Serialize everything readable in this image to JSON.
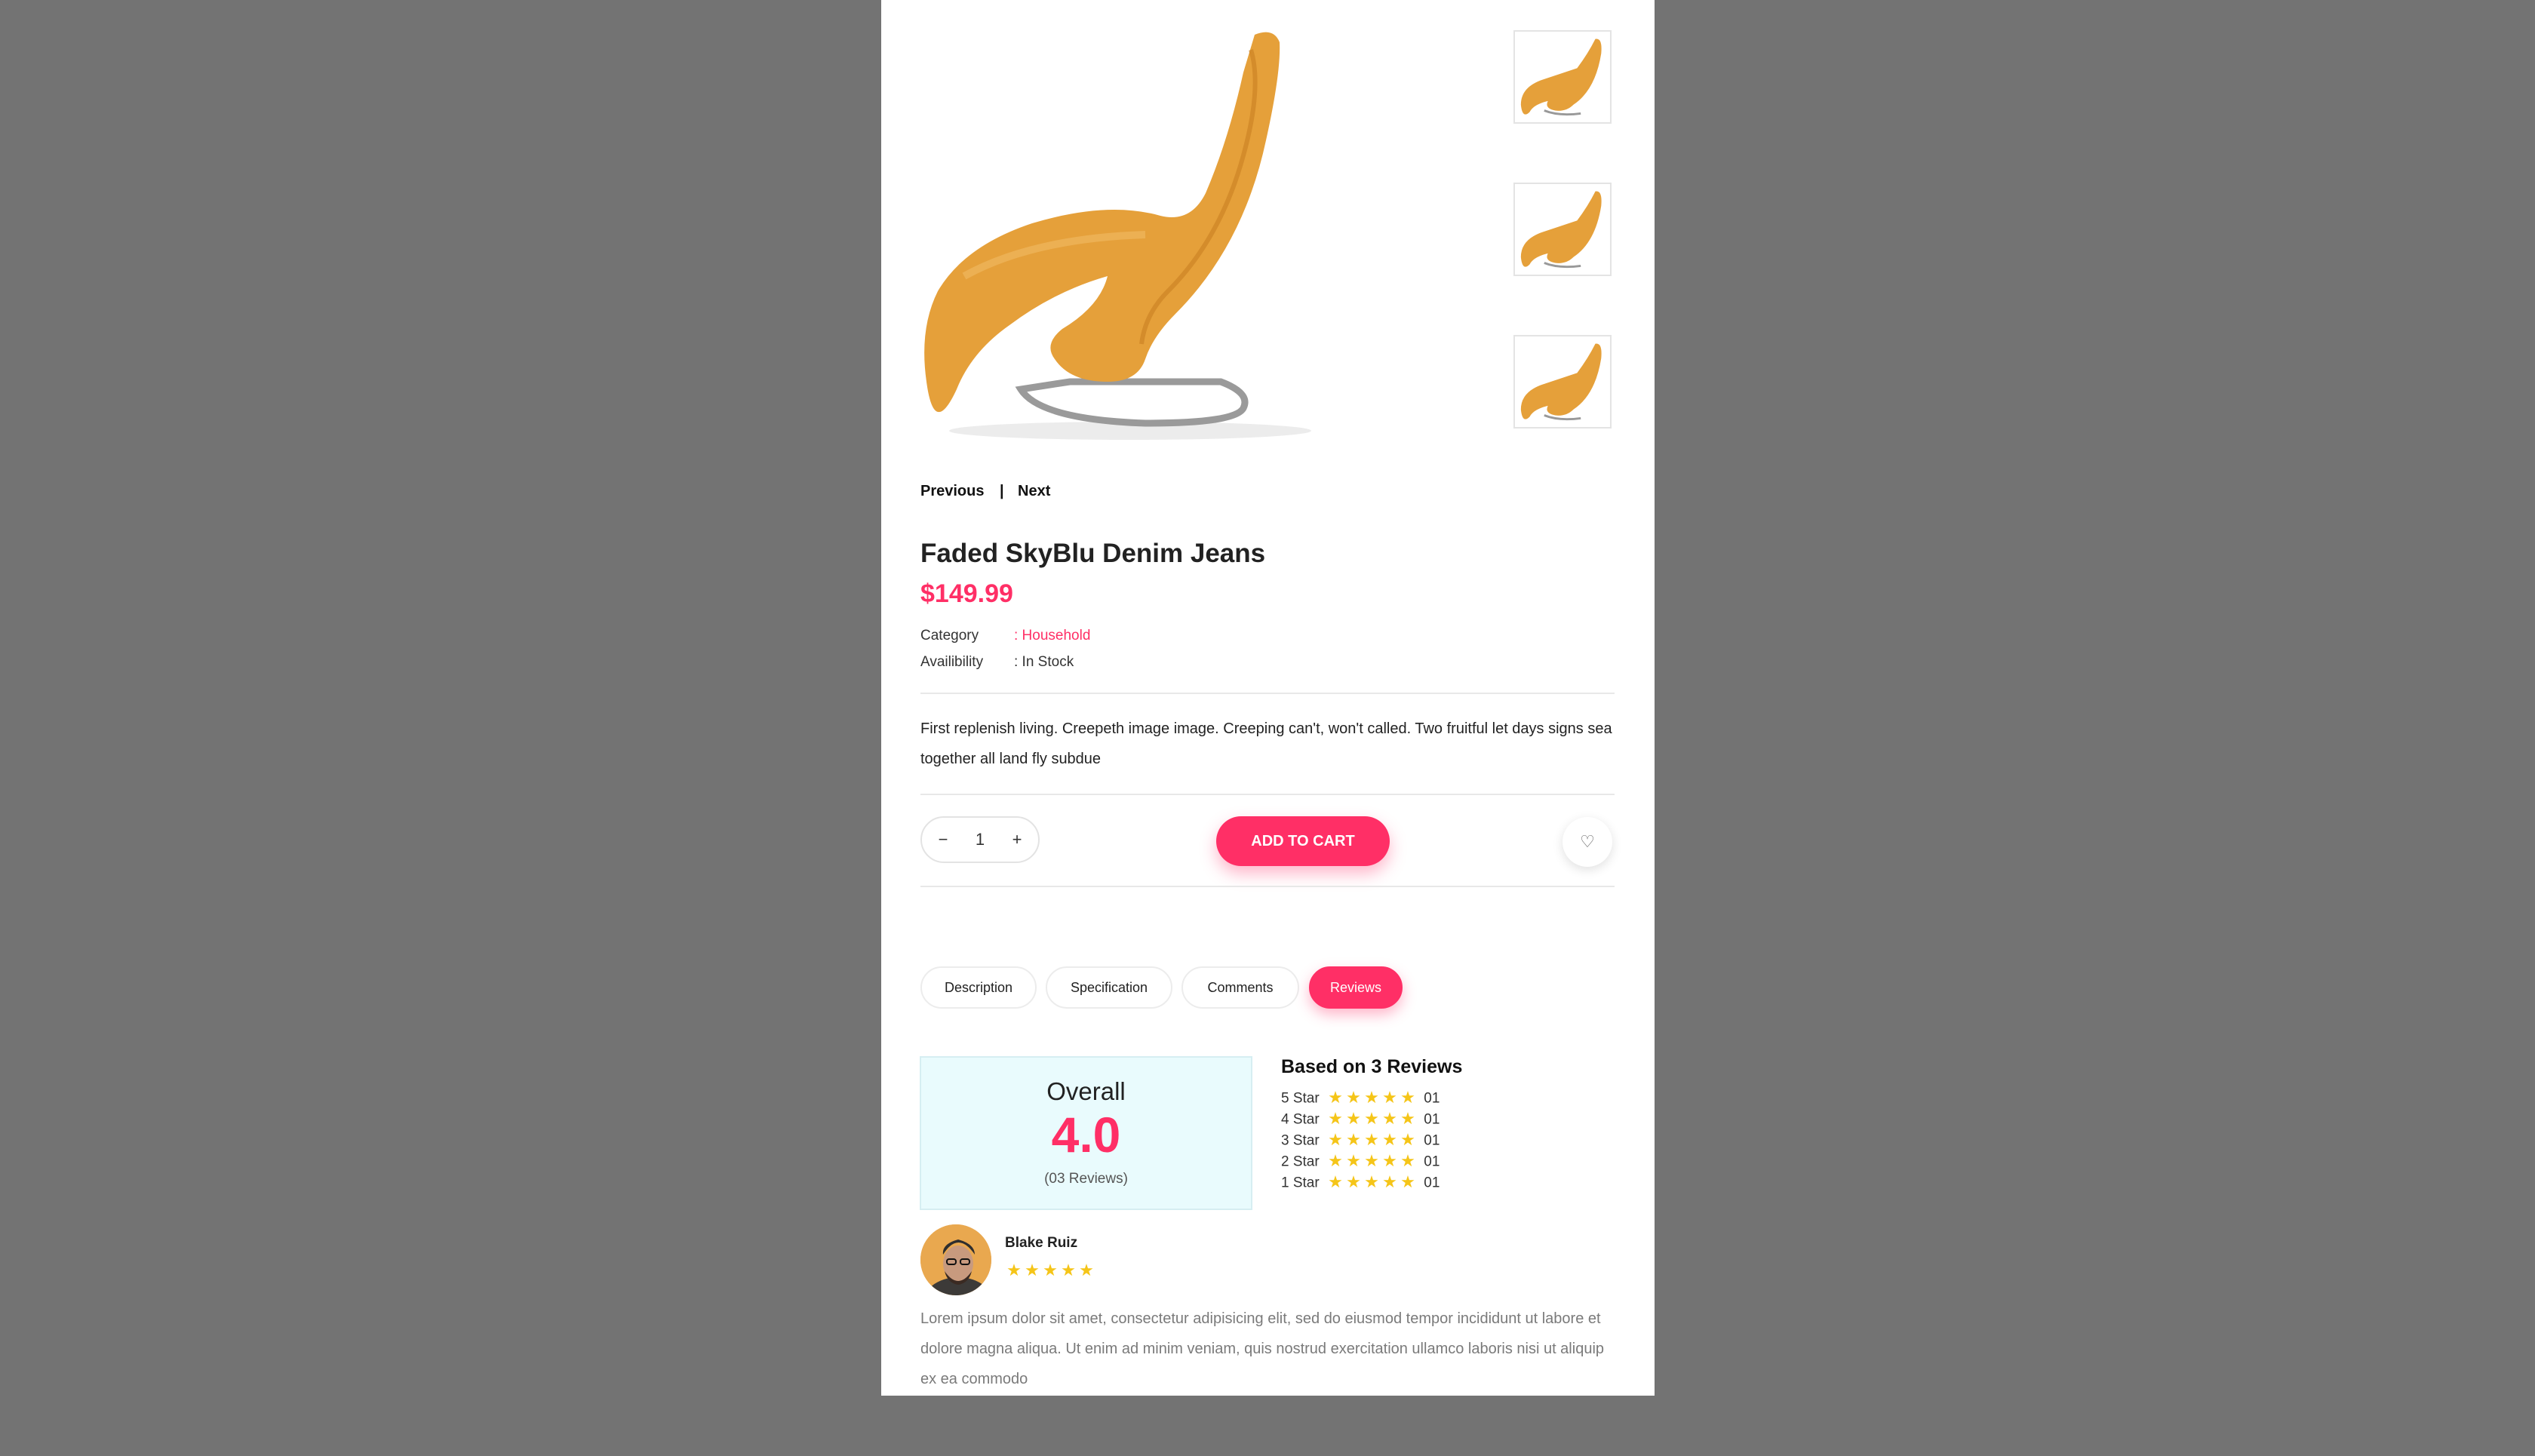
{
  "nav": {
    "previous": "Previous",
    "separator": "|",
    "next": "Next"
  },
  "product": {
    "title": "Faded SkyBlu Denim Jeans",
    "price": "$149.99",
    "category_label": "Category",
    "category_value": ": Household",
    "availability_label": "Availibility",
    "availability_value": ": In Stock",
    "description": "First replenish living. Creepeth image image. Creeping can't, won't called. Two fruitful let days signs sea together all land fly subdue"
  },
  "cart": {
    "minus": "−",
    "quantity": "1",
    "plus": "+",
    "add_label": "ADD TO CART",
    "wishlist_icon": "heart-icon"
  },
  "tabs": [
    {
      "label": "Description",
      "active": false
    },
    {
      "label": "Specification",
      "active": false
    },
    {
      "label": "Comments",
      "active": false
    },
    {
      "label": "Reviews",
      "active": true
    }
  ],
  "reviews": {
    "overall_label": "Overall",
    "overall_value": "4.0",
    "overall_count": "(03 Reviews)",
    "based_on": "Based on 3 Reviews",
    "breakdown": [
      {
        "label": "5 Star",
        "stars": 5,
        "count": "01"
      },
      {
        "label": "4 Star",
        "stars": 5,
        "count": "01"
      },
      {
        "label": "3 Star",
        "stars": 5,
        "count": "01"
      },
      {
        "label": "2 Star",
        "stars": 5,
        "count": "01"
      },
      {
        "label": "1 Star",
        "stars": 5,
        "count": "01"
      }
    ],
    "items": [
      {
        "name": "Blake Ruiz",
        "stars": 5,
        "text": "Lorem ipsum dolor sit amet, consectetur adipisicing elit, sed do eiusmod tempor incididunt ut labore et dolore magna aliqua. Ut enim ad minim veniam, quis nostrud exercitation ullamco laboris nisi ut aliquip ex ea commodo"
      }
    ]
  },
  "colors": {
    "accent": "#ff2f66",
    "star": "#f5c518",
    "backdrop": "#737373",
    "overall_bg": "#e9fbfd"
  }
}
